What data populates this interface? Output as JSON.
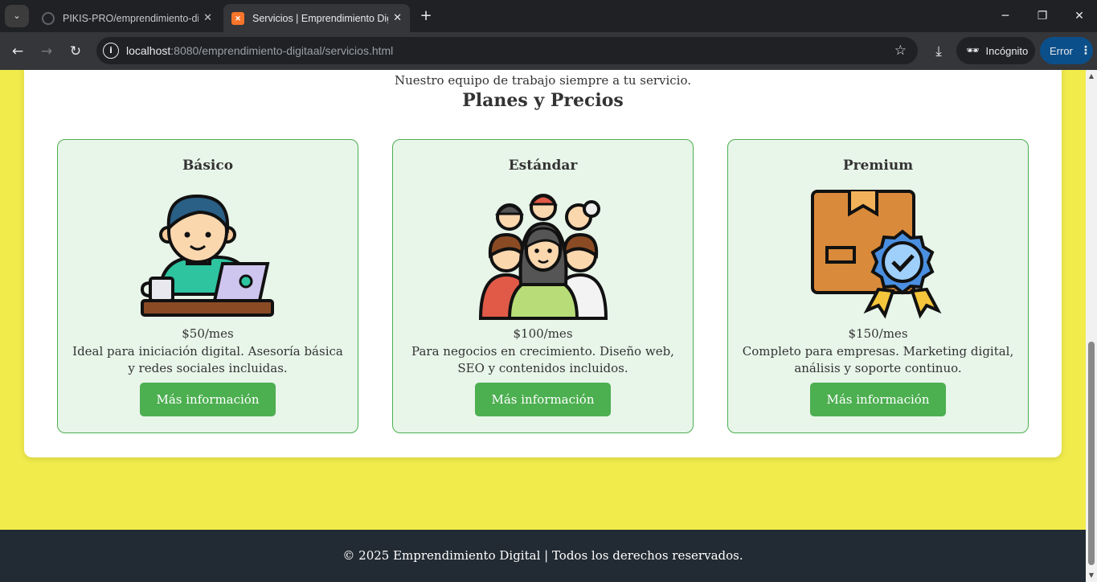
{
  "browser": {
    "tabs": [
      {
        "title": "PIKIS-PRO/emprendimiento-digital",
        "active": false
      },
      {
        "title": "Servicios | Emprendimiento Digital",
        "active": true
      }
    ],
    "url_host": "localhost",
    "url_path": ":8080/emprendimiento-digitaal/servicios.html",
    "incognito_label": "Incógnito",
    "error_label": "Error"
  },
  "page": {
    "tagline": "Nuestro equipo de trabajo siempre a tu servicio.",
    "section_title": "Planes y Precios",
    "plans": [
      {
        "name": "Básico",
        "price": "$50/mes",
        "description": "Ideal para iniciación digital. Asesoría básica y redes sociales incluidas.",
        "button": "Más información",
        "icon": "person-laptop-icon"
      },
      {
        "name": "Estándar",
        "price": "$100/mes",
        "description": "Para negocios en crecimiento. Diseño web, SEO y contenidos incluidos.",
        "button": "Más información",
        "icon": "team-group-icon"
      },
      {
        "name": "Premium",
        "price": "$150/mes",
        "description": "Completo para empresas. Marketing digital, análisis y soporte continuo.",
        "button": "Más información",
        "icon": "box-badge-icon"
      }
    ],
    "footer": "© 2025 Emprendimiento Digital | Todos los derechos reservados."
  },
  "colors": {
    "page_background": "#f1ec4c",
    "card_background": "#e8f5e9",
    "accent_green": "#4caf50",
    "footer_background": "#222b33"
  }
}
